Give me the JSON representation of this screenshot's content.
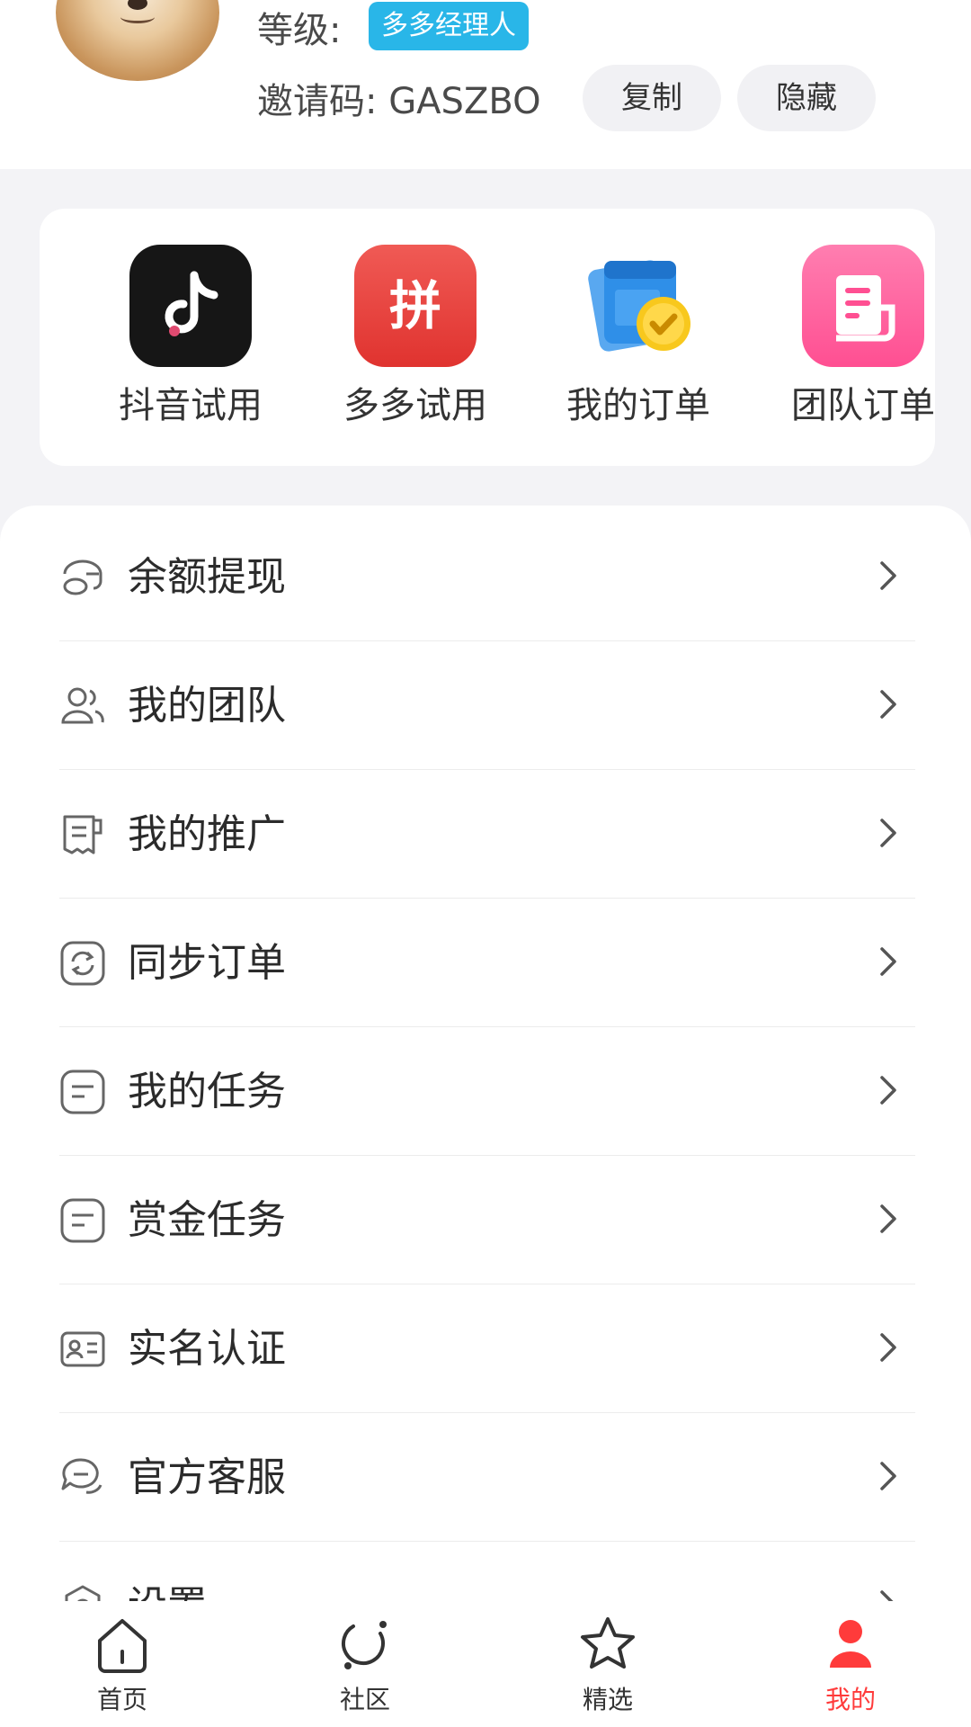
{
  "profile": {
    "level_label": "等级:",
    "level_badge": "多多经理人",
    "invite_label": "邀请码: GASZBO",
    "copy_label": "复制",
    "hide_label": "隐藏"
  },
  "quick_actions": [
    {
      "label": "抖音试用",
      "icon": "tiktok-icon"
    },
    {
      "label": "多多试用",
      "icon": "pinduoduo-icon"
    },
    {
      "label": "我的订单",
      "icon": "order-calendar-icon"
    },
    {
      "label": "团队订单",
      "icon": "team-order-icon"
    }
  ],
  "pdd_glyph": "拼",
  "menu": [
    {
      "label": "余额提现",
      "icon": "wallet-icon"
    },
    {
      "label": "我的团队",
      "icon": "team-icon"
    },
    {
      "label": "我的推广",
      "icon": "promotion-icon"
    },
    {
      "label": "同步订单",
      "icon": "sync-icon"
    },
    {
      "label": "我的任务",
      "icon": "task-icon"
    },
    {
      "label": "赏金任务",
      "icon": "bounty-task-icon"
    },
    {
      "label": "实名认证",
      "icon": "id-card-icon"
    },
    {
      "label": "官方客服",
      "icon": "chat-icon"
    },
    {
      "label": "设置",
      "icon": "settings-icon"
    }
  ],
  "tabbar": {
    "home": "首页",
    "community": "社区",
    "featured": "精选",
    "me": "我的"
  },
  "colors": {
    "badge": "#29b6e8",
    "active_tab": "#ff3b3b",
    "page_bg": "#f3f3f6"
  }
}
